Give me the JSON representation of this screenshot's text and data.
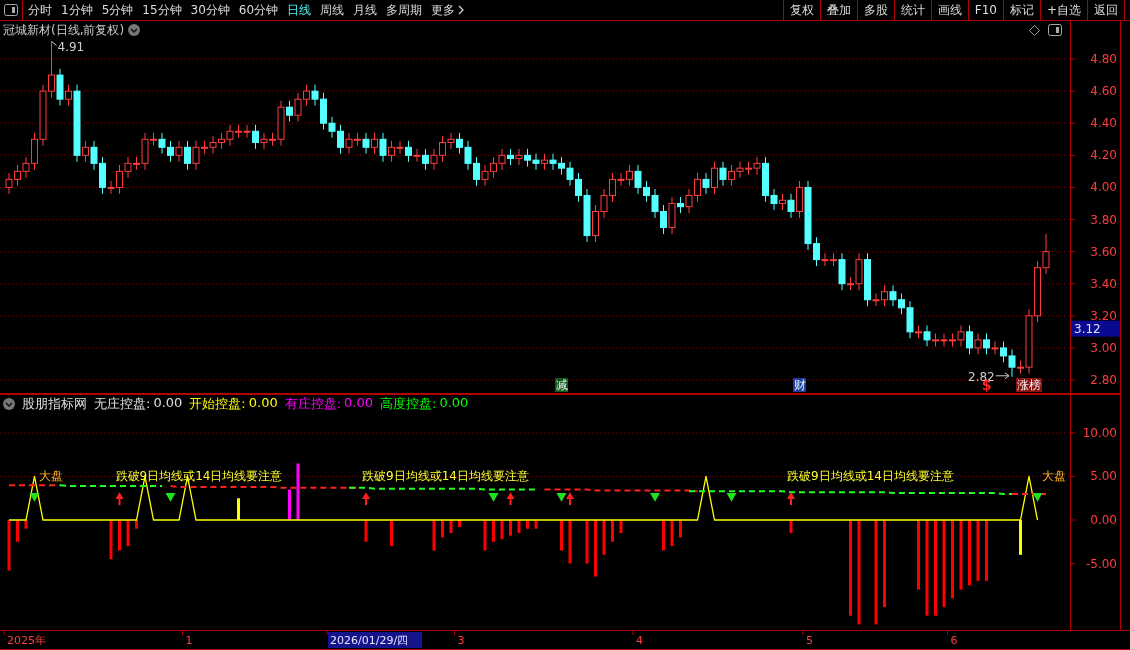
{
  "toolbar": {
    "tabs": [
      {
        "label": "分时",
        "selected": false
      },
      {
        "label": "1分钟",
        "selected": false
      },
      {
        "label": "5分钟",
        "selected": false
      },
      {
        "label": "15分钟",
        "selected": false
      },
      {
        "label": "30分钟",
        "selected": false
      },
      {
        "label": "60分钟",
        "selected": false
      },
      {
        "label": "日线",
        "selected": true
      },
      {
        "label": "周线",
        "selected": false
      },
      {
        "label": "月线",
        "selected": false
      },
      {
        "label": "多周期",
        "selected": false
      }
    ],
    "more": "更多",
    "buttons": [
      "复权",
      "叠加",
      "多股",
      "统计",
      "画线",
      "F10",
      "标记",
      "+自选",
      "返回"
    ]
  },
  "price_pane": {
    "title": "冠城新材(日线,前复权)",
    "high_label": "4.91",
    "low_label": "2.82",
    "current_price": "3.12",
    "markers": [
      {
        "text": "减",
        "kind": "badge",
        "color": "#0f5a1e"
      },
      {
        "text": "财",
        "kind": "badge",
        "color": "#1b3f9a"
      },
      {
        "text": "$",
        "kind": "symbol",
        "color": "#ff2020"
      },
      {
        "text": "涨榜",
        "kind": "badge",
        "color": "#8a1010"
      }
    ],
    "chart_data": {
      "type": "candlestick",
      "grid": true,
      "ylim": [
        2.7128,
        5.037
      ],
      "yticks": [
        {
          "value": 4.8,
          "label": "4.80"
        },
        {
          "value": 4.6,
          "label": "4.60"
        },
        {
          "value": 4.4,
          "label": "4.40"
        },
        {
          "value": 4.2,
          "label": "4.20"
        },
        {
          "value": 4.0,
          "label": "4.00"
        },
        {
          "value": 3.8,
          "label": "3.80"
        },
        {
          "value": 3.6,
          "label": "3.60"
        },
        {
          "value": 3.4,
          "label": "3.40"
        },
        {
          "value": 3.2,
          "label": "3.20"
        },
        {
          "value": 3.0,
          "label": "3.00"
        },
        {
          "value": 2.8,
          "label": "2.80"
        }
      ],
      "categories": [
        null,
        null,
        null,
        null,
        null,
        null,
        null,
        null,
        null,
        null,
        null,
        null,
        null,
        null,
        null,
        null,
        null,
        null,
        null,
        null,
        null,
        null,
        null,
        null,
        null,
        null,
        null,
        null,
        null,
        null,
        null,
        null,
        null,
        null,
        null,
        null,
        null,
        null,
        null,
        null,
        null,
        null,
        null,
        null,
        null,
        null,
        null,
        null,
        null,
        null,
        null,
        null,
        null,
        null,
        null,
        null,
        null,
        null,
        null,
        null,
        null,
        null,
        null,
        null,
        null,
        null,
        null,
        null,
        null,
        null,
        null,
        null,
        null,
        null,
        null,
        null,
        null,
        null,
        null,
        null,
        null,
        null,
        null,
        null,
        null,
        null,
        null,
        null,
        null,
        null,
        null,
        null,
        null,
        null,
        null,
        null,
        null,
        null,
        null,
        null,
        null,
        null,
        null,
        null,
        null,
        null,
        null,
        null,
        null,
        null,
        null,
        null,
        null,
        null,
        null,
        null,
        null,
        null,
        null,
        null,
        null,
        null,
        null
      ],
      "ohlc": [
        [
          4.0,
          4.09,
          3.96,
          4.05
        ],
        [
          4.05,
          4.14,
          4.01,
          4.1
        ],
        [
          4.1,
          4.19,
          4.06,
          4.15
        ],
        [
          4.15,
          4.34,
          4.11,
          4.3
        ],
        [
          4.3,
          4.64,
          4.26,
          4.6
        ],
        [
          4.6,
          4.91,
          4.56,
          4.7
        ],
        [
          4.7,
          4.74,
          4.51,
          4.55
        ],
        [
          4.55,
          4.64,
          4.51,
          4.6
        ],
        [
          4.6,
          4.64,
          4.16,
          4.2
        ],
        [
          4.2,
          4.29,
          4.16,
          4.25
        ],
        [
          4.25,
          4.29,
          4.11,
          4.15
        ],
        [
          4.15,
          4.19,
          3.96,
          4.0
        ],
        [
          4.0,
          4.04,
          3.96,
          4.0
        ],
        [
          4.0,
          4.14,
          3.96,
          4.1
        ],
        [
          4.1,
          4.19,
          4.06,
          4.15
        ],
        [
          4.15,
          4.19,
          4.11,
          4.15
        ],
        [
          4.15,
          4.34,
          4.11,
          4.3
        ],
        [
          4.3,
          4.34,
          4.26,
          4.3
        ],
        [
          4.3,
          4.34,
          4.21,
          4.25
        ],
        [
          4.25,
          4.29,
          4.16,
          4.2
        ],
        [
          4.2,
          4.29,
          4.16,
          4.25
        ],
        [
          4.25,
          4.29,
          4.11,
          4.15
        ],
        [
          4.15,
          4.29,
          4.11,
          4.25
        ],
        [
          4.25,
          4.29,
          4.21,
          4.25
        ],
        [
          4.25,
          4.32,
          4.21,
          4.28
        ],
        [
          4.28,
          4.34,
          4.24,
          4.3
        ],
        [
          4.3,
          4.39,
          4.26,
          4.35
        ],
        [
          4.35,
          4.39,
          4.31,
          4.35
        ],
        [
          4.35,
          4.39,
          4.31,
          4.35
        ],
        [
          4.35,
          4.39,
          4.24,
          4.28
        ],
        [
          4.28,
          4.34,
          4.24,
          4.3
        ],
        [
          4.3,
          4.34,
          4.26,
          4.3
        ],
        [
          4.3,
          4.54,
          4.26,
          4.5
        ],
        [
          4.5,
          4.54,
          4.41,
          4.45
        ],
        [
          4.45,
          4.59,
          4.41,
          4.55
        ],
        [
          4.55,
          4.64,
          4.51,
          4.6
        ],
        [
          4.6,
          4.64,
          4.51,
          4.55
        ],
        [
          4.55,
          4.59,
          4.36,
          4.4
        ],
        [
          4.4,
          4.44,
          4.31,
          4.35
        ],
        [
          4.35,
          4.39,
          4.21,
          4.25
        ],
        [
          4.25,
          4.34,
          4.21,
          4.3
        ],
        [
          4.3,
          4.34,
          4.26,
          4.3
        ],
        [
          4.3,
          4.34,
          4.21,
          4.25
        ],
        [
          4.25,
          4.34,
          4.21,
          4.3
        ],
        [
          4.3,
          4.34,
          4.16,
          4.2
        ],
        [
          4.2,
          4.29,
          4.16,
          4.25
        ],
        [
          4.25,
          4.29,
          4.21,
          4.25
        ],
        [
          4.25,
          4.29,
          4.16,
          4.2
        ],
        [
          4.2,
          4.24,
          4.16,
          4.2
        ],
        [
          4.2,
          4.24,
          4.11,
          4.15
        ],
        [
          4.15,
          4.24,
          4.11,
          4.2
        ],
        [
          4.2,
          4.32,
          4.16,
          4.28
        ],
        [
          4.28,
          4.34,
          4.24,
          4.3
        ],
        [
          4.3,
          4.34,
          4.21,
          4.25
        ],
        [
          4.25,
          4.29,
          4.11,
          4.15
        ],
        [
          4.15,
          4.19,
          4.01,
          4.05
        ],
        [
          4.05,
          4.14,
          4.01,
          4.1
        ],
        [
          4.1,
          4.19,
          4.06,
          4.15
        ],
        [
          4.15,
          4.24,
          4.11,
          4.2
        ],
        [
          4.2,
          4.24,
          4.14,
          4.18
        ],
        [
          4.18,
          4.24,
          4.14,
          4.2
        ],
        [
          4.2,
          4.24,
          4.13,
          4.17
        ],
        [
          4.17,
          4.21,
          4.11,
          4.15
        ],
        [
          4.15,
          4.21,
          4.11,
          4.17
        ],
        [
          4.17,
          4.21,
          4.11,
          4.15
        ],
        [
          4.15,
          4.19,
          4.08,
          4.12
        ],
        [
          4.12,
          4.16,
          4.01,
          4.05
        ],
        [
          4.05,
          4.09,
          3.91,
          3.95
        ],
        [
          3.95,
          3.99,
          3.66,
          3.7
        ],
        [
          3.7,
          3.89,
          3.66,
          3.85
        ],
        [
          3.85,
          3.99,
          3.81,
          3.95
        ],
        [
          3.95,
          4.09,
          3.91,
          4.05
        ],
        [
          4.05,
          4.09,
          4.01,
          4.05
        ],
        [
          4.05,
          4.14,
          4.01,
          4.1
        ],
        [
          4.1,
          4.14,
          3.96,
          4.0
        ],
        [
          4.0,
          4.04,
          3.91,
          3.95
        ],
        [
          3.95,
          3.99,
          3.81,
          3.85
        ],
        [
          3.85,
          3.89,
          3.71,
          3.75
        ],
        [
          3.75,
          3.94,
          3.71,
          3.9
        ],
        [
          3.9,
          3.94,
          3.84,
          3.88
        ],
        [
          3.88,
          3.99,
          3.84,
          3.95
        ],
        [
          3.95,
          4.09,
          3.91,
          4.05
        ],
        [
          4.05,
          4.09,
          3.96,
          4.0
        ],
        [
          4.0,
          4.16,
          3.96,
          4.12
        ],
        [
          4.12,
          4.16,
          4.01,
          4.05
        ],
        [
          4.05,
          4.14,
          4.01,
          4.1
        ],
        [
          4.1,
          4.16,
          4.06,
          4.12
        ],
        [
          4.12,
          4.16,
          4.08,
          4.12
        ],
        [
          4.12,
          4.19,
          4.08,
          4.15
        ],
        [
          4.15,
          4.19,
          3.91,
          3.95
        ],
        [
          3.95,
          3.99,
          3.86,
          3.9
        ],
        [
          3.9,
          3.96,
          3.86,
          3.92
        ],
        [
          3.92,
          3.96,
          3.81,
          3.85
        ],
        [
          3.85,
          4.04,
          3.81,
          4.0
        ],
        [
          4.0,
          4.04,
          3.61,
          3.65
        ],
        [
          3.65,
          3.69,
          3.51,
          3.55
        ],
        [
          3.55,
          3.59,
          3.51,
          3.55
        ],
        [
          3.55,
          3.59,
          3.51,
          3.55
        ],
        [
          3.55,
          3.59,
          3.36,
          3.4
        ],
        [
          3.4,
          3.44,
          3.36,
          3.4
        ],
        [
          3.4,
          3.59,
          3.36,
          3.55
        ],
        [
          3.55,
          3.59,
          3.26,
          3.3
        ],
        [
          3.3,
          3.34,
          3.26,
          3.3
        ],
        [
          3.3,
          3.39,
          3.26,
          3.35
        ],
        [
          3.35,
          3.39,
          3.26,
          3.3
        ],
        [
          3.3,
          3.34,
          3.21,
          3.25
        ],
        [
          3.25,
          3.29,
          3.06,
          3.1
        ],
        [
          3.1,
          3.14,
          3.06,
          3.1
        ],
        [
          3.1,
          3.14,
          3.01,
          3.05
        ],
        [
          3.05,
          3.09,
          3.01,
          3.05
        ],
        [
          3.05,
          3.09,
          3.01,
          3.05
        ],
        [
          3.05,
          3.09,
          3.01,
          3.05
        ],
        [
          3.05,
          3.14,
          3.01,
          3.1
        ],
        [
          3.1,
          3.14,
          2.96,
          3.0
        ],
        [
          3.0,
          3.09,
          2.96,
          3.05
        ],
        [
          3.05,
          3.09,
          2.96,
          3.0
        ],
        [
          3.0,
          3.04,
          2.96,
          3.0
        ],
        [
          3.0,
          3.04,
          2.91,
          2.95
        ],
        [
          2.95,
          2.99,
          2.82,
          2.88
        ],
        [
          2.88,
          2.92,
          2.84,
          2.88
        ],
        [
          2.88,
          3.24,
          2.84,
          3.2
        ],
        [
          3.2,
          3.54,
          3.16,
          3.5
        ],
        [
          3.5,
          3.71,
          3.46,
          3.6
        ]
      ]
    }
  },
  "indicator_pane": {
    "title": "股朋指标网",
    "readings": [
      {
        "label": "无庄控盘:",
        "value": "0.00",
        "color": "#e0e0e0"
      },
      {
        "label": "开始控盘:",
        "value": "0.00",
        "color": "#ffff00"
      },
      {
        "label": "有庄控盘:",
        "value": "0.00",
        "color": "#ff00ff"
      },
      {
        "label": "高度控盘:",
        "value": "0.00",
        "color": "#00ff00"
      }
    ],
    "annotations": [
      {
        "text": "大盘",
        "kind": "market"
      },
      {
        "text": "跌破9日均线或14日均线要注意",
        "kind": "warning"
      },
      {
        "text": "跌破9日均线或14日均线要注意",
        "kind": "warning"
      },
      {
        "text": "跌破9日均线或14日均线要注意",
        "kind": "warning"
      },
      {
        "text": "大盘",
        "kind": "market"
      }
    ],
    "signals": [
      {
        "kind": "up"
      },
      {
        "kind": "up"
      },
      {
        "kind": "up"
      },
      {
        "kind": "up"
      },
      {
        "kind": "up"
      },
      {
        "kind": "down"
      },
      {
        "kind": "down"
      },
      {
        "kind": "down"
      },
      {
        "kind": "down"
      },
      {
        "kind": "down"
      },
      {
        "kind": "down"
      },
      {
        "kind": "down"
      }
    ],
    "chart_data": {
      "type": "bar",
      "grid": true,
      "ylim": [
        -12.64,
        14.48
      ],
      "yticks": [
        {
          "value": 10,
          "label": "10.00"
        },
        {
          "value": 5,
          "label": "5.00"
        },
        {
          "value": 0,
          "label": "0.00"
        },
        {
          "value": -5,
          "label": "-5.00"
        }
      ],
      "categories": [
        null,
        null,
        null,
        null,
        null,
        null,
        null,
        null,
        null,
        null,
        null,
        null,
        null,
        null,
        null,
        null,
        null,
        null,
        null,
        null,
        null,
        null,
        null,
        null,
        null,
        null,
        null,
        null,
        null,
        null,
        null,
        null,
        null,
        null,
        null,
        null,
        null,
        null,
        null,
        null,
        null,
        null,
        null,
        null,
        null,
        null,
        null,
        null,
        null,
        null,
        null,
        null,
        null,
        null,
        null,
        null,
        null,
        null,
        null,
        null,
        null,
        null,
        null,
        null,
        null,
        null,
        null,
        null,
        null,
        null,
        null,
        null,
        null,
        null,
        null,
        null,
        null,
        null,
        null,
        null,
        null,
        null,
        null,
        null,
        null,
        null,
        null,
        null,
        null,
        null,
        null,
        null,
        null,
        null,
        null,
        null,
        null,
        null,
        null,
        null,
        null,
        null,
        null,
        null,
        null,
        null,
        null,
        null,
        null,
        null,
        null,
        null,
        null,
        null,
        null,
        null,
        null,
        null,
        null,
        null,
        null,
        null,
        null
      ],
      "series": [
        {
          "color": "#ff0000",
          "values": [
            -5.8,
            -2.5,
            -1,
            null,
            null,
            null,
            null,
            null,
            null,
            null,
            null,
            null,
            -4.5,
            -3.5,
            -3,
            -1,
            null,
            null,
            null,
            null,
            null,
            null,
            null,
            null,
            null,
            null,
            null,
            null,
            null,
            null,
            null,
            null,
            null,
            null,
            null,
            null,
            null,
            null,
            null,
            null,
            null,
            null,
            -2.5,
            null,
            null,
            -3,
            null,
            null,
            null,
            null,
            -3.5,
            -2,
            -1.5,
            -0.8,
            null,
            null,
            -3.5,
            -2.5,
            -2.2,
            -1.8,
            -1.5,
            -1,
            -1,
            null,
            null,
            -3.5,
            -5,
            null,
            -5,
            -6.5,
            -4,
            -2.5,
            -1.5,
            null,
            null,
            null,
            null,
            -3.5,
            -3,
            -2,
            null,
            null,
            null,
            null,
            null,
            null,
            null,
            null,
            null,
            null,
            null,
            null,
            -1.5,
            null,
            null,
            null,
            null,
            null,
            null,
            -11,
            -12,
            null,
            -12,
            -10,
            null,
            null,
            null,
            -8,
            -11,
            -11,
            -10,
            -9,
            -8,
            -7.5,
            -7,
            -7,
            null,
            null,
            null,
            null,
            null,
            null,
            null
          ]
        },
        {
          "color": "#ffff00",
          "values": [
            null,
            null,
            null,
            null,
            null,
            null,
            null,
            null,
            null,
            null,
            null,
            null,
            null,
            null,
            null,
            null,
            null,
            null,
            null,
            null,
            null,
            null,
            null,
            null,
            null,
            null,
            null,
            2.5,
            null,
            null,
            null,
            null,
            null,
            null,
            null,
            null,
            null,
            null,
            null,
            null,
            null,
            null,
            null,
            null,
            null,
            null,
            null,
            null,
            null,
            null,
            null,
            null,
            null,
            null,
            null,
            null,
            null,
            null,
            null,
            null,
            null,
            null,
            null,
            null,
            null,
            null,
            null,
            null,
            null,
            null,
            null,
            null,
            null,
            null,
            null,
            null,
            null,
            null,
            null,
            null,
            null,
            null,
            null,
            null,
            null,
            null,
            null,
            null,
            null,
            null,
            null,
            null,
            null,
            null,
            null,
            null,
            null,
            null,
            null,
            null,
            null,
            null,
            null,
            null,
            null,
            null,
            null,
            null,
            null,
            null,
            null,
            null,
            null,
            null,
            null,
            null,
            null,
            null,
            null,
            -4,
            null,
            null,
            null
          ]
        },
        {
          "color": "#ff00ff",
          "values": [
            null,
            null,
            null,
            null,
            null,
            null,
            null,
            null,
            null,
            null,
            null,
            null,
            null,
            null,
            null,
            null,
            null,
            null,
            null,
            null,
            null,
            null,
            null,
            null,
            null,
            null,
            null,
            null,
            null,
            null,
            null,
            null,
            null,
            3.5,
            6.5,
            null,
            null,
            null,
            null,
            null,
            null,
            null,
            null,
            null,
            null,
            null,
            null,
            null,
            null,
            null,
            null,
            null,
            null,
            null,
            null,
            null,
            null,
            null,
            null,
            null,
            null,
            null,
            null,
            null,
            null,
            null,
            null,
            null,
            null,
            null,
            null,
            null,
            null,
            null,
            null,
            null,
            null,
            null,
            null,
            null,
            null,
            null,
            null,
            null,
            null,
            null,
            null,
            null,
            null,
            null,
            null,
            null,
            null,
            null,
            null,
            null,
            null,
            null,
            null,
            null,
            null,
            null,
            null,
            null,
            null,
            null,
            null,
            null,
            null,
            null,
            null,
            null,
            null,
            null,
            null,
            null,
            null,
            null,
            null,
            null,
            null,
            null,
            null
          ]
        },
        {
          "color": "#ffff00",
          "type": "line",
          "values": [
            0,
            0,
            0,
            5,
            0,
            0,
            0,
            0,
            0,
            0,
            0,
            0,
            0,
            0,
            0,
            0,
            5,
            0,
            0,
            0,
            0,
            5,
            0,
            0,
            0,
            0,
            0,
            0,
            0,
            0,
            0,
            0,
            0,
            0,
            0,
            0,
            0,
            0,
            0,
            0,
            0,
            0,
            0,
            0,
            0,
            0,
            0,
            0,
            0,
            0,
            0,
            0,
            0,
            0,
            0,
            0,
            0,
            0,
            0,
            0,
            0,
            0,
            0,
            0,
            0,
            0,
            0,
            0,
            0,
            0,
            0,
            0,
            0,
            0,
            0,
            0,
            0,
            0,
            0,
            0,
            0,
            0,
            5,
            0,
            0,
            0,
            0,
            0,
            0,
            0,
            0,
            0,
            0,
            0,
            0,
            0,
            0,
            0,
            0,
            0,
            0,
            0,
            0,
            0,
            0,
            0,
            0,
            0,
            0,
            0,
            0,
            0,
            0,
            0,
            0,
            0,
            0,
            0,
            0,
            0,
            5,
            0,
            null
          ]
        },
        {
          "color": "#ff2020",
          "type": "line",
          "line_style": "dashed",
          "values": [
            4.0,
            4.0,
            4.0,
            4.0,
            4.0,
            4.0,
            4.0,
            null,
            null,
            null,
            null,
            null,
            null,
            null,
            null,
            null,
            null,
            null,
            null,
            3.9,
            3.8,
            3.8,
            3.8,
            3.8,
            3.8,
            3.8,
            3.8,
            3.8,
            3.8,
            3.8,
            3.8,
            3.8,
            3.7,
            3.7,
            3.7,
            3.7,
            3.7,
            3.7,
            3.7,
            3.7,
            3.7,
            3.7,
            null,
            null,
            null,
            null,
            null,
            null,
            null,
            null,
            null,
            null,
            null,
            null,
            null,
            null,
            null,
            null,
            null,
            null,
            null,
            null,
            null,
            3.5,
            3.5,
            3.5,
            3.5,
            3.5,
            3.5,
            3.4,
            3.4,
            3.4,
            3.4,
            3.4,
            3.4,
            3.4,
            3.4,
            3.4,
            3.4,
            3.4,
            3.4,
            3.3,
            null,
            null,
            null,
            null,
            null,
            null,
            null,
            null,
            null,
            null,
            null,
            null,
            null,
            null,
            null,
            null,
            null,
            null,
            null,
            null,
            null,
            null,
            null,
            null,
            null,
            null,
            null,
            null,
            null,
            null,
            null,
            null,
            null,
            null,
            null,
            null,
            3.0,
            3.0,
            3.0,
            3.0,
            3.0
          ]
        },
        {
          "color": "#20ff20",
          "type": "line",
          "line_style": "dashed",
          "values": [
            null,
            null,
            null,
            null,
            null,
            null,
            4.0,
            3.9,
            3.9,
            3.9,
            3.9,
            3.9,
            3.9,
            3.9,
            3.9,
            3.9,
            3.9,
            3.9,
            3.9,
            null,
            null,
            null,
            null,
            null,
            null,
            null,
            null,
            null,
            null,
            null,
            null,
            null,
            null,
            null,
            null,
            null,
            null,
            null,
            null,
            null,
            3.7,
            3.7,
            3.7,
            3.6,
            3.6,
            3.6,
            3.6,
            3.6,
            3.6,
            3.6,
            3.6,
            3.6,
            3.6,
            3.6,
            3.6,
            3.6,
            3.5,
            3.5,
            3.5,
            3.5,
            3.5,
            3.5,
            3.5,
            null,
            null,
            null,
            null,
            null,
            null,
            null,
            null,
            null,
            null,
            null,
            null,
            null,
            null,
            null,
            null,
            null,
            3.3,
            3.3,
            3.3,
            3.3,
            3.3,
            3.3,
            3.3,
            3.3,
            3.3,
            3.3,
            3.3,
            3.3,
            3.2,
            3.2,
            3.2,
            3.2,
            3.2,
            3.2,
            3.2,
            3.2,
            3.2,
            3.2,
            3.2,
            3.2,
            3.1,
            3.1,
            3.1,
            3.1,
            3.1,
            3.1,
            3.1,
            3.1,
            3.1,
            3.1,
            3.1,
            3.1,
            3.1,
            3.0,
            3.0,
            null,
            null,
            null,
            null
          ]
        }
      ]
    }
  },
  "time_axis": {
    "labels": [
      {
        "text": "2025年",
        "selected": false
      },
      {
        "text": "1",
        "selected": false
      },
      {
        "text": "2026/01/29/四",
        "selected": true
      },
      {
        "text": "3",
        "selected": false
      },
      {
        "text": "4",
        "selected": false
      },
      {
        "text": "5",
        "selected": false
      },
      {
        "text": "6",
        "selected": false
      }
    ]
  }
}
